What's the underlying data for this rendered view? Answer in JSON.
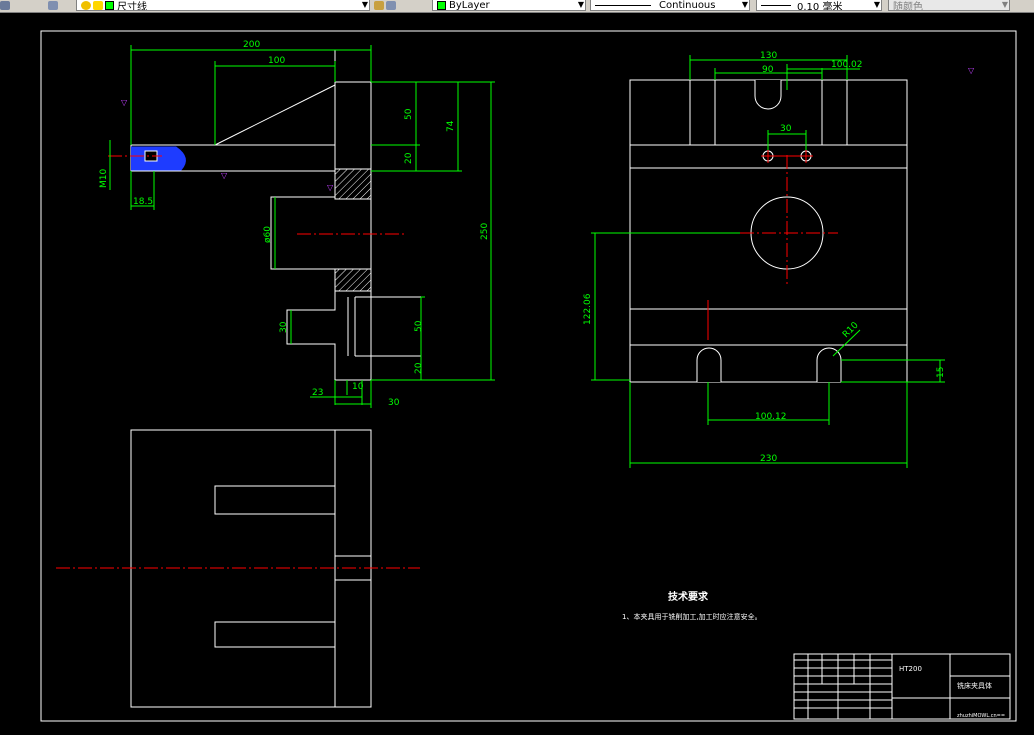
{
  "toolbar": {
    "layer_value": "尺寸线",
    "color_value": "ByLayer",
    "linetype_value": "Continuous",
    "lineweight_value": "0.10 毫米",
    "plotstyle_value": "随颜色",
    "layer_color": "#00ff00"
  },
  "colors": {
    "background": "#000000",
    "outline": "#ffffff",
    "dimension": "#00ff00",
    "centerline": "#ff0000",
    "hatch": "#1e3cff"
  },
  "dims": {
    "d200": "200",
    "d100": "100",
    "d50a": "50",
    "d74": "74",
    "d20a": "20",
    "d250": "250",
    "m10": "M10",
    "d18_5": "18.5",
    "d60": "ø60",
    "d30a": "30",
    "d50b": "50",
    "d20b": "20",
    "d23": "23",
    "d10": "10",
    "d30b": "30",
    "d130": "130",
    "d90": "90",
    "d100_02": "100.02",
    "d30c": "30",
    "d122_06": "122.06",
    "r10": "R10",
    "d15": "15",
    "d100_12": "100.12",
    "d230": "230"
  },
  "notes": {
    "title": "技术要求",
    "line1": "1、本夹具用于铣削加工,加工时应注意安全。"
  },
  "title_block": {
    "material": "HT200",
    "name": "铣床夹具体",
    "footer": "zhuzhiMOWL.cn=="
  }
}
